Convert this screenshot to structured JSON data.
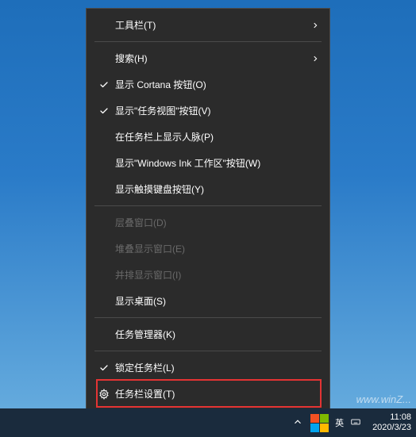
{
  "menu": {
    "items": [
      {
        "label": "工具栏(T)",
        "icon": null,
        "hasSubmenu": true,
        "disabled": false
      },
      {
        "separator": true
      },
      {
        "label": "搜索(H)",
        "icon": null,
        "hasSubmenu": true,
        "disabled": false
      },
      {
        "label": "显示 Cortana 按钮(O)",
        "icon": "check",
        "hasSubmenu": false,
        "disabled": false
      },
      {
        "label": "显示\"任务视图\"按钮(V)",
        "icon": "check",
        "hasSubmenu": false,
        "disabled": false
      },
      {
        "label": "在任务栏上显示人脉(P)",
        "icon": null,
        "hasSubmenu": false,
        "disabled": false
      },
      {
        "label": "显示\"Windows Ink 工作区\"按钮(W)",
        "icon": null,
        "hasSubmenu": false,
        "disabled": false
      },
      {
        "label": "显示触摸键盘按钮(Y)",
        "icon": null,
        "hasSubmenu": false,
        "disabled": false
      },
      {
        "separator": true
      },
      {
        "label": "层叠窗口(D)",
        "icon": null,
        "hasSubmenu": false,
        "disabled": true
      },
      {
        "label": "堆叠显示窗口(E)",
        "icon": null,
        "hasSubmenu": false,
        "disabled": true
      },
      {
        "label": "并排显示窗口(I)",
        "icon": null,
        "hasSubmenu": false,
        "disabled": true
      },
      {
        "label": "显示桌面(S)",
        "icon": null,
        "hasSubmenu": false,
        "disabled": false
      },
      {
        "separator": true
      },
      {
        "label": "任务管理器(K)",
        "icon": null,
        "hasSubmenu": false,
        "disabled": false
      },
      {
        "separator": true
      },
      {
        "label": "锁定任务栏(L)",
        "icon": "check",
        "hasSubmenu": false,
        "disabled": false
      },
      {
        "label": "任务栏设置(T)",
        "icon": "gear",
        "hasSubmenu": false,
        "disabled": false,
        "highlighted": true
      }
    ]
  },
  "taskbar": {
    "ime_status": "英",
    "time": "11:08",
    "date": "2020/3/23"
  },
  "watermark": "www.winZ..."
}
